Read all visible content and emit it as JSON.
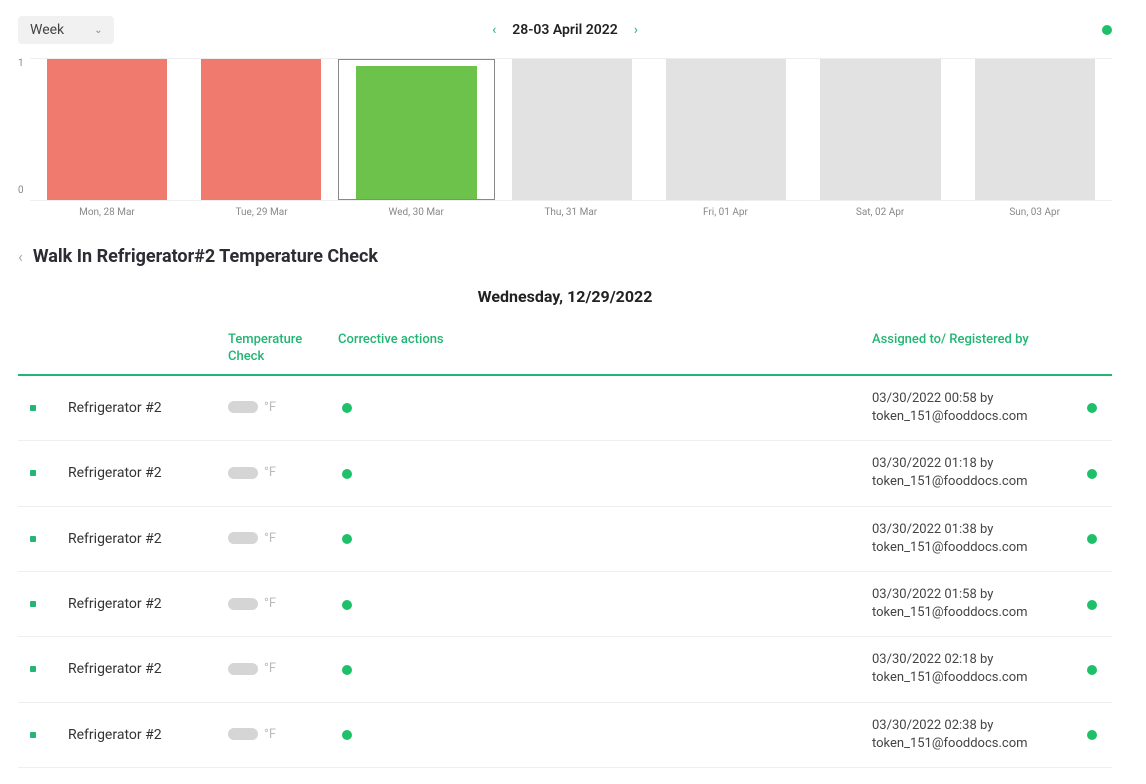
{
  "topbar": {
    "period_label": "Week",
    "date_range": "28-03 April 2022"
  },
  "chart_data": {
    "type": "bar",
    "categories": [
      "Mon, 28 Mar",
      "Tue, 29 Mar",
      "Wed, 30 Mar",
      "Thu, 31 Mar",
      "Fri, 01 Apr",
      "Sat, 02 Apr",
      "Sun, 03 Apr"
    ],
    "values": [
      1,
      1,
      1,
      1,
      1,
      1,
      1
    ],
    "colors": [
      "red",
      "red",
      "green",
      "gray",
      "gray",
      "gray",
      "gray"
    ],
    "selected_index": 2,
    "ylim": [
      0,
      1
    ],
    "yticks": [
      "1",
      "0"
    ]
  },
  "page": {
    "title": "Walk In Refrigerator#2 Temperature Check",
    "subtitle": "Wednesday, 12/29/2022"
  },
  "headers": {
    "temp": "Temperature Check",
    "corrective": "Corrective actions",
    "assigned": "Assigned to/ Registered by"
  },
  "rows": [
    {
      "name": "Refrigerator #2",
      "unit": "°F",
      "ts": "03/30/2022 00:58 by",
      "by": "token_151@fooddocs.com"
    },
    {
      "name": "Refrigerator #2",
      "unit": "°F",
      "ts": "03/30/2022 01:18 by",
      "by": "token_151@fooddocs.com"
    },
    {
      "name": "Refrigerator #2",
      "unit": "°F",
      "ts": "03/30/2022 01:38 by",
      "by": "token_151@fooddocs.com"
    },
    {
      "name": "Refrigerator #2",
      "unit": "°F",
      "ts": "03/30/2022 01:58 by",
      "by": "token_151@fooddocs.com"
    },
    {
      "name": "Refrigerator #2",
      "unit": "°F",
      "ts": "03/30/2022 02:18 by",
      "by": "token_151@fooddocs.com"
    },
    {
      "name": "Refrigerator #2",
      "unit": "°F",
      "ts": "03/30/2022 02:38 by",
      "by": "token_151@fooddocs.com"
    }
  ]
}
